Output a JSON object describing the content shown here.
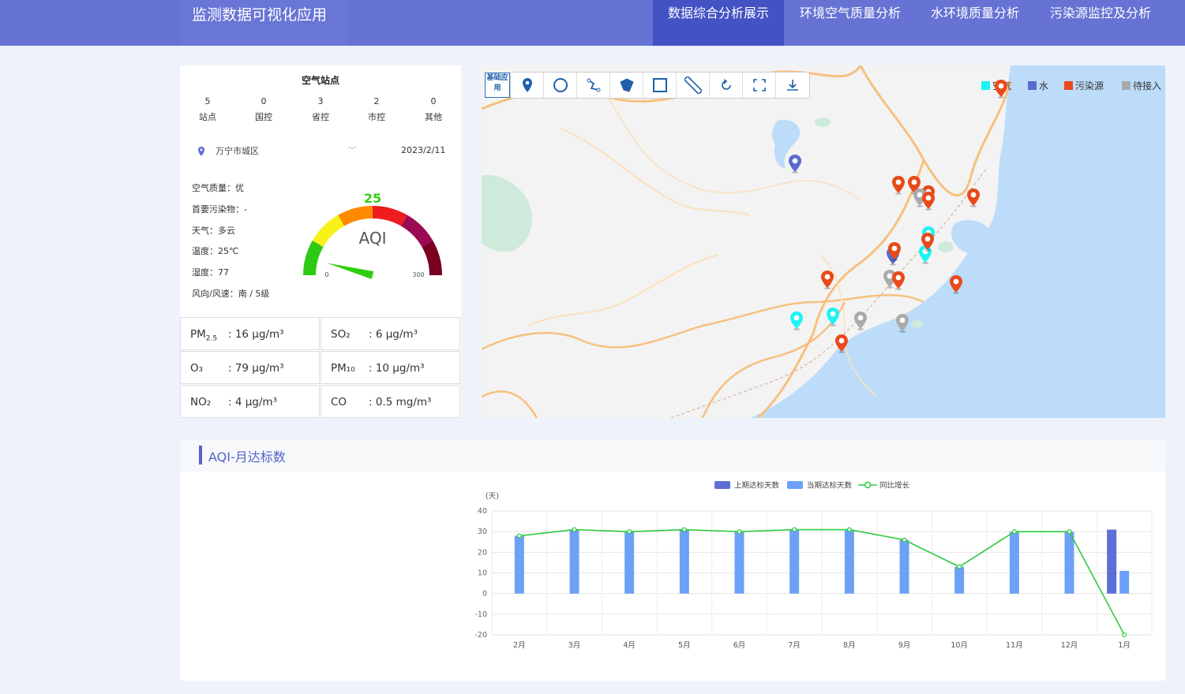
{
  "app_title": "监测数据可视化应用",
  "nav": [
    {
      "label": "数据综合分析展示",
      "active": true
    },
    {
      "label": "环境空气质量分析",
      "active": false
    },
    {
      "label": "水环境质量分析",
      "active": false
    },
    {
      "label": "污染源监控及分析",
      "active": false
    }
  ],
  "station": {
    "title": "空气站点",
    "stats": [
      {
        "value": "5",
        "label": "站点"
      },
      {
        "value": "0",
        "label": "国控"
      },
      {
        "value": "3",
        "label": "省控"
      },
      {
        "value": "2",
        "label": "市控"
      },
      {
        "value": "0",
        "label": "其他"
      }
    ],
    "location": "万宁市城区",
    "date": "2023/2/11"
  },
  "air": {
    "quality": "空气质量：优",
    "primary_pollutant": "首要污染物：-",
    "weather": "天气：多云",
    "temperature": "温度：25℃",
    "humidity": "湿度：77",
    "wind": "风向/风速：南 / 5级"
  },
  "gauge": {
    "value": 25,
    "label": "AQI",
    "min_label": "0",
    "max_label": "300",
    "min": 0,
    "max": 300,
    "value_color": "#2fcf10"
  },
  "pollutants": [
    {
      "name": "PM2.5",
      "value": ": 16 μg/m³"
    },
    {
      "name": "SO₂",
      "value": ": 6 μg/m³"
    },
    {
      "name": "O₃",
      "value": ": 79 μg/m³"
    },
    {
      "name": "PM₁₀",
      "value": ": 10 μg/m³"
    },
    {
      "name": "NO₂",
      "value": ": 4 μg/m³"
    },
    {
      "name": "CO",
      "value": ": 0.5 mg/m³"
    }
  ],
  "map": {
    "tool_label": "基础应用",
    "tools": [
      "location-icon",
      "circle-icon",
      "polyline-icon",
      "polygon-icon",
      "rectangle-icon",
      "ruler-icon",
      "refresh-icon",
      "fullscreen-icon",
      "download-icon"
    ],
    "legend": [
      {
        "label": "空气",
        "color": "#1ef3f3"
      },
      {
        "label": "水",
        "color": "#5a6ad0"
      },
      {
        "label": "污染源",
        "color": "#e84a1a"
      },
      {
        "label": "待接入",
        "color": "#aaaaaa"
      }
    ]
  },
  "aqi_section": {
    "title": "AQI-月达标数"
  },
  "chart_data": {
    "type": "bar",
    "title": "",
    "ylabel": "(天)",
    "ylim": [
      -20,
      40
    ],
    "yticks": [
      40,
      30,
      20,
      10,
      0,
      -10,
      -20
    ],
    "categories": [
      "2月",
      "3月",
      "4月",
      "5月",
      "6月",
      "7月",
      "8月",
      "9月",
      "10月",
      "11月",
      "12月",
      "1月"
    ],
    "legend_position": "top-center",
    "series": [
      {
        "name": "上期达标天数",
        "type": "bar",
        "color": "#5b6fd6",
        "values": [
          0,
          0,
          0,
          0,
          0,
          0,
          0,
          0,
          0,
          0,
          0,
          31
        ]
      },
      {
        "name": "当期达标天数",
        "type": "bar",
        "color": "#6da0f7",
        "values": [
          28,
          31,
          30,
          31,
          30,
          31,
          31,
          26,
          13,
          30,
          30,
          11
        ]
      },
      {
        "name": "同比增长",
        "type": "line",
        "color": "#2ecc40",
        "values": [
          28,
          31,
          30,
          31,
          30,
          31,
          31,
          26,
          13,
          30,
          30,
          -20
        ]
      }
    ]
  }
}
